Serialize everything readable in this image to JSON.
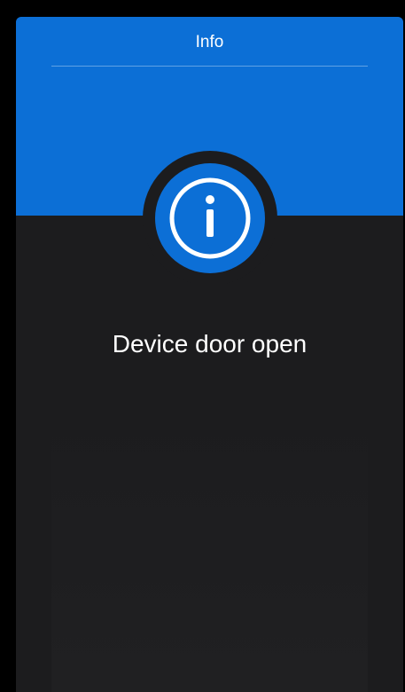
{
  "header": {
    "title": "Info"
  },
  "info_icon": {
    "icon": "info-icon",
    "color": "#0c6fd6"
  },
  "message": {
    "text": "Device door open"
  },
  "colors": {
    "accent": "#0c6fd6",
    "background": "#1c1c1e",
    "text": "#ffffff"
  }
}
